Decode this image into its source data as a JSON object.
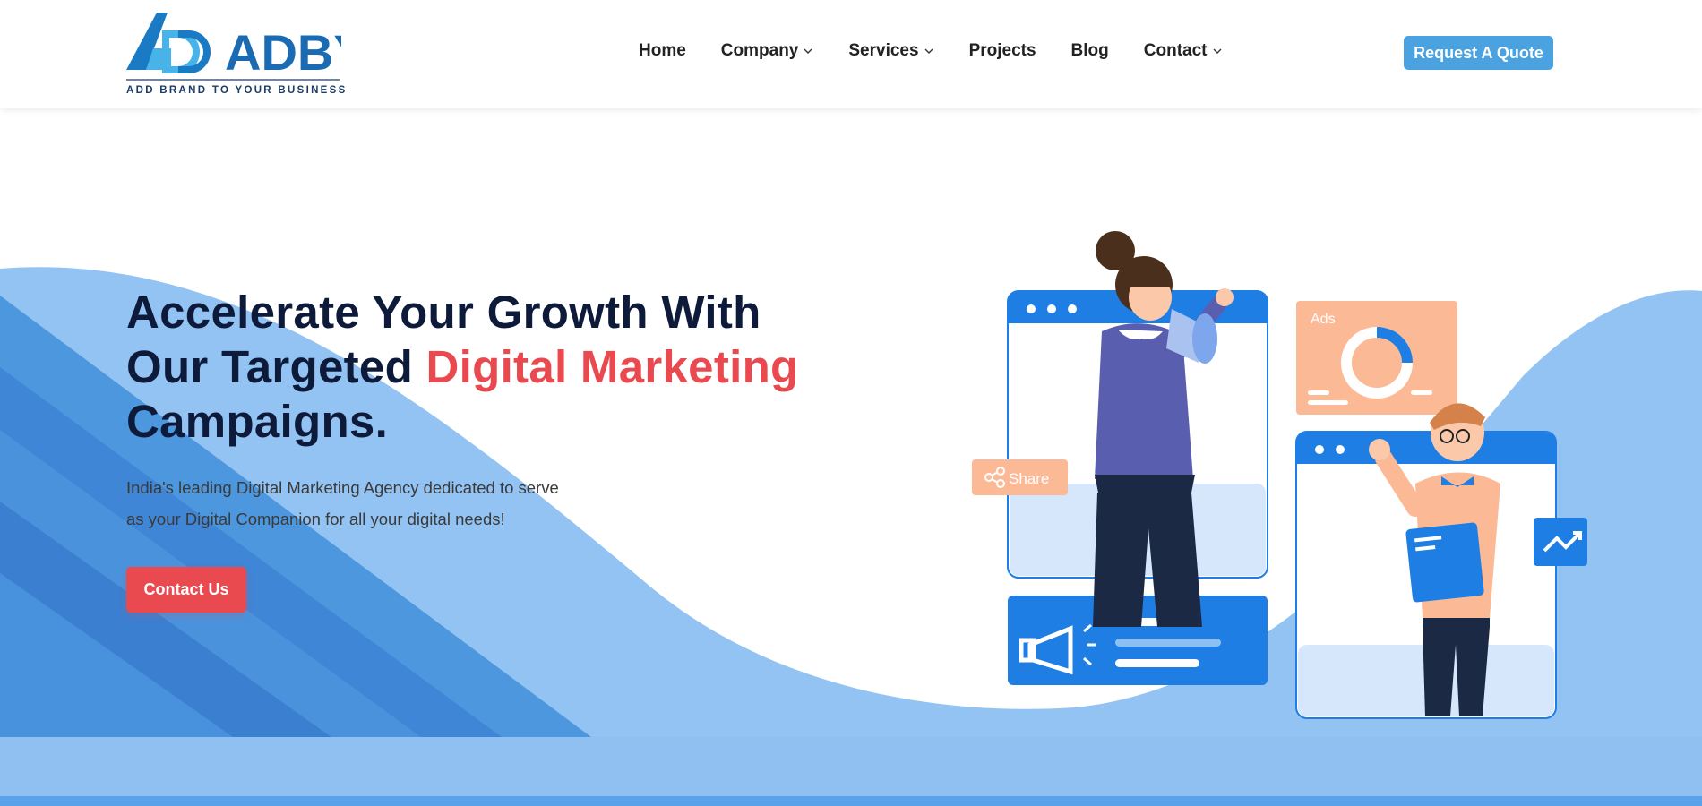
{
  "brand": {
    "logo_text": "ADBYB",
    "tagline": "ADD BRAND TO YOUR BUSINESS"
  },
  "nav": {
    "items": [
      {
        "label": "Home",
        "has_dropdown": false
      },
      {
        "label": "Company",
        "has_dropdown": true
      },
      {
        "label": "Services",
        "has_dropdown": true
      },
      {
        "label": "Projects",
        "has_dropdown": false
      },
      {
        "label": "Blog",
        "has_dropdown": false
      },
      {
        "label": "Contact",
        "has_dropdown": true
      }
    ],
    "cta_label": "Request A Quote"
  },
  "hero": {
    "title_line1": "Accelerate Your Growth With",
    "title_line2_prefix": "Our Targeted ",
    "title_line2_accent": "Digital Marketing",
    "title_line3": "Campaigns.",
    "subtitle_line1": "India's leading Digital Marketing Agency dedicated to serve",
    "subtitle_line2": "as your Digital Companion for all your digital needs!",
    "cta_label": "Contact Us"
  },
  "illustration": {
    "share_label": "Share",
    "ads_label": "Ads"
  },
  "colors": {
    "brand_blue": "#1a7ac4",
    "accent_red": "#e84a4f",
    "quote_button": "#4aa3e0",
    "wave_light": "#93c3f2",
    "wave_dark": "#3f86d6",
    "peach": "#fbb995"
  }
}
